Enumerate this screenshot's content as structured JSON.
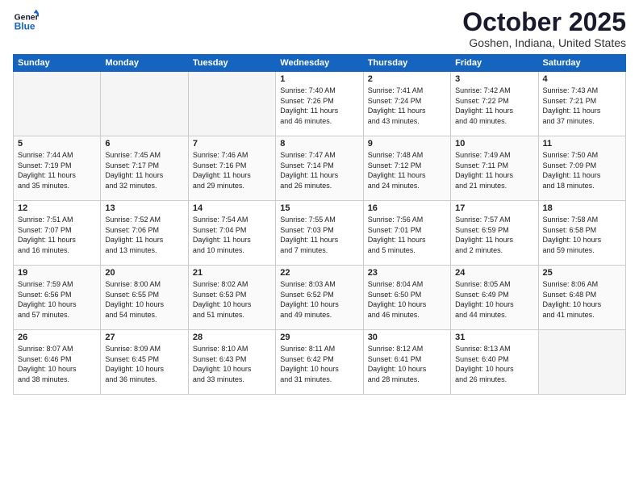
{
  "header": {
    "logo_line1": "General",
    "logo_line2": "Blue",
    "month": "October 2025",
    "location": "Goshen, Indiana, United States"
  },
  "weekdays": [
    "Sunday",
    "Monday",
    "Tuesday",
    "Wednesday",
    "Thursday",
    "Friday",
    "Saturday"
  ],
  "weeks": [
    [
      {
        "day": "",
        "info": ""
      },
      {
        "day": "",
        "info": ""
      },
      {
        "day": "",
        "info": ""
      },
      {
        "day": "1",
        "info": "Sunrise: 7:40 AM\nSunset: 7:26 PM\nDaylight: 11 hours\nand 46 minutes."
      },
      {
        "day": "2",
        "info": "Sunrise: 7:41 AM\nSunset: 7:24 PM\nDaylight: 11 hours\nand 43 minutes."
      },
      {
        "day": "3",
        "info": "Sunrise: 7:42 AM\nSunset: 7:22 PM\nDaylight: 11 hours\nand 40 minutes."
      },
      {
        "day": "4",
        "info": "Sunrise: 7:43 AM\nSunset: 7:21 PM\nDaylight: 11 hours\nand 37 minutes."
      }
    ],
    [
      {
        "day": "5",
        "info": "Sunrise: 7:44 AM\nSunset: 7:19 PM\nDaylight: 11 hours\nand 35 minutes."
      },
      {
        "day": "6",
        "info": "Sunrise: 7:45 AM\nSunset: 7:17 PM\nDaylight: 11 hours\nand 32 minutes."
      },
      {
        "day": "7",
        "info": "Sunrise: 7:46 AM\nSunset: 7:16 PM\nDaylight: 11 hours\nand 29 minutes."
      },
      {
        "day": "8",
        "info": "Sunrise: 7:47 AM\nSunset: 7:14 PM\nDaylight: 11 hours\nand 26 minutes."
      },
      {
        "day": "9",
        "info": "Sunrise: 7:48 AM\nSunset: 7:12 PM\nDaylight: 11 hours\nand 24 minutes."
      },
      {
        "day": "10",
        "info": "Sunrise: 7:49 AM\nSunset: 7:11 PM\nDaylight: 11 hours\nand 21 minutes."
      },
      {
        "day": "11",
        "info": "Sunrise: 7:50 AM\nSunset: 7:09 PM\nDaylight: 11 hours\nand 18 minutes."
      }
    ],
    [
      {
        "day": "12",
        "info": "Sunrise: 7:51 AM\nSunset: 7:07 PM\nDaylight: 11 hours\nand 16 minutes."
      },
      {
        "day": "13",
        "info": "Sunrise: 7:52 AM\nSunset: 7:06 PM\nDaylight: 11 hours\nand 13 minutes."
      },
      {
        "day": "14",
        "info": "Sunrise: 7:54 AM\nSunset: 7:04 PM\nDaylight: 11 hours\nand 10 minutes."
      },
      {
        "day": "15",
        "info": "Sunrise: 7:55 AM\nSunset: 7:03 PM\nDaylight: 11 hours\nand 7 minutes."
      },
      {
        "day": "16",
        "info": "Sunrise: 7:56 AM\nSunset: 7:01 PM\nDaylight: 11 hours\nand 5 minutes."
      },
      {
        "day": "17",
        "info": "Sunrise: 7:57 AM\nSunset: 6:59 PM\nDaylight: 11 hours\nand 2 minutes."
      },
      {
        "day": "18",
        "info": "Sunrise: 7:58 AM\nSunset: 6:58 PM\nDaylight: 10 hours\nand 59 minutes."
      }
    ],
    [
      {
        "day": "19",
        "info": "Sunrise: 7:59 AM\nSunset: 6:56 PM\nDaylight: 10 hours\nand 57 minutes."
      },
      {
        "day": "20",
        "info": "Sunrise: 8:00 AM\nSunset: 6:55 PM\nDaylight: 10 hours\nand 54 minutes."
      },
      {
        "day": "21",
        "info": "Sunrise: 8:02 AM\nSunset: 6:53 PM\nDaylight: 10 hours\nand 51 minutes."
      },
      {
        "day": "22",
        "info": "Sunrise: 8:03 AM\nSunset: 6:52 PM\nDaylight: 10 hours\nand 49 minutes."
      },
      {
        "day": "23",
        "info": "Sunrise: 8:04 AM\nSunset: 6:50 PM\nDaylight: 10 hours\nand 46 minutes."
      },
      {
        "day": "24",
        "info": "Sunrise: 8:05 AM\nSunset: 6:49 PM\nDaylight: 10 hours\nand 44 minutes."
      },
      {
        "day": "25",
        "info": "Sunrise: 8:06 AM\nSunset: 6:48 PM\nDaylight: 10 hours\nand 41 minutes."
      }
    ],
    [
      {
        "day": "26",
        "info": "Sunrise: 8:07 AM\nSunset: 6:46 PM\nDaylight: 10 hours\nand 38 minutes."
      },
      {
        "day": "27",
        "info": "Sunrise: 8:09 AM\nSunset: 6:45 PM\nDaylight: 10 hours\nand 36 minutes."
      },
      {
        "day": "28",
        "info": "Sunrise: 8:10 AM\nSunset: 6:43 PM\nDaylight: 10 hours\nand 33 minutes."
      },
      {
        "day": "29",
        "info": "Sunrise: 8:11 AM\nSunset: 6:42 PM\nDaylight: 10 hours\nand 31 minutes."
      },
      {
        "day": "30",
        "info": "Sunrise: 8:12 AM\nSunset: 6:41 PM\nDaylight: 10 hours\nand 28 minutes."
      },
      {
        "day": "31",
        "info": "Sunrise: 8:13 AM\nSunset: 6:40 PM\nDaylight: 10 hours\nand 26 minutes."
      },
      {
        "day": "",
        "info": ""
      }
    ]
  ]
}
